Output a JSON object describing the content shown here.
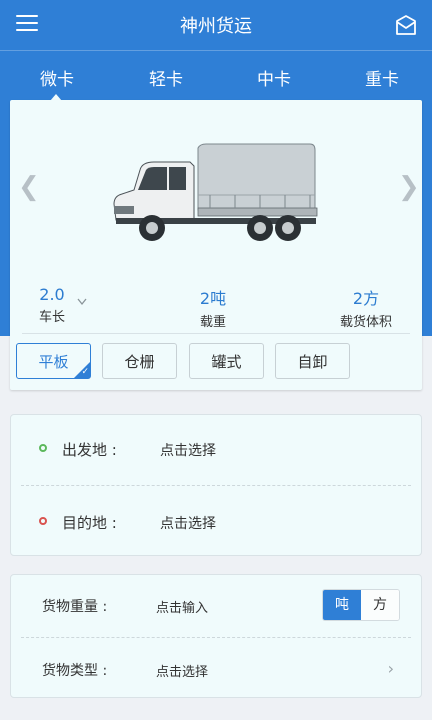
{
  "header": {
    "title": "神州货运",
    "menu_icon": "hamburger-menu-icon",
    "mail_icon": "mail-icon"
  },
  "tabs": [
    {
      "label": "微卡",
      "active": true
    },
    {
      "label": "轻卡"
    },
    {
      "label": "中卡"
    },
    {
      "label": "重卡"
    }
  ],
  "carousel": {
    "prev": "❮",
    "next": "❯",
    "image": "light-truck-image"
  },
  "specs": {
    "length": {
      "value": "2.0",
      "label": "车长"
    },
    "load": {
      "value": "2吨",
      "label": "载重"
    },
    "volume": {
      "value": "2方",
      "label": "载货体积"
    }
  },
  "truck_types": [
    {
      "label": "平板",
      "selected": true
    },
    {
      "label": "仓栅"
    },
    {
      "label": "罐式"
    },
    {
      "label": "自卸"
    }
  ],
  "route": {
    "origin": {
      "label": "出发地 :",
      "value": "点击选择"
    },
    "destination": {
      "label": "目的地 :",
      "value": "点击选择"
    }
  },
  "cargo": {
    "weight": {
      "label": "货物重量 :",
      "value": "点击输入",
      "units": [
        "吨",
        "方"
      ]
    },
    "type": {
      "label": "货物类型 :",
      "value": "点击选择"
    }
  },
  "colors": {
    "primary": "#2f7fd6",
    "card_bg": "#f0fbfc",
    "page_bg": "#eef1f5",
    "origin_dot": "#5cb85c",
    "dest_dot": "#d9534f"
  }
}
